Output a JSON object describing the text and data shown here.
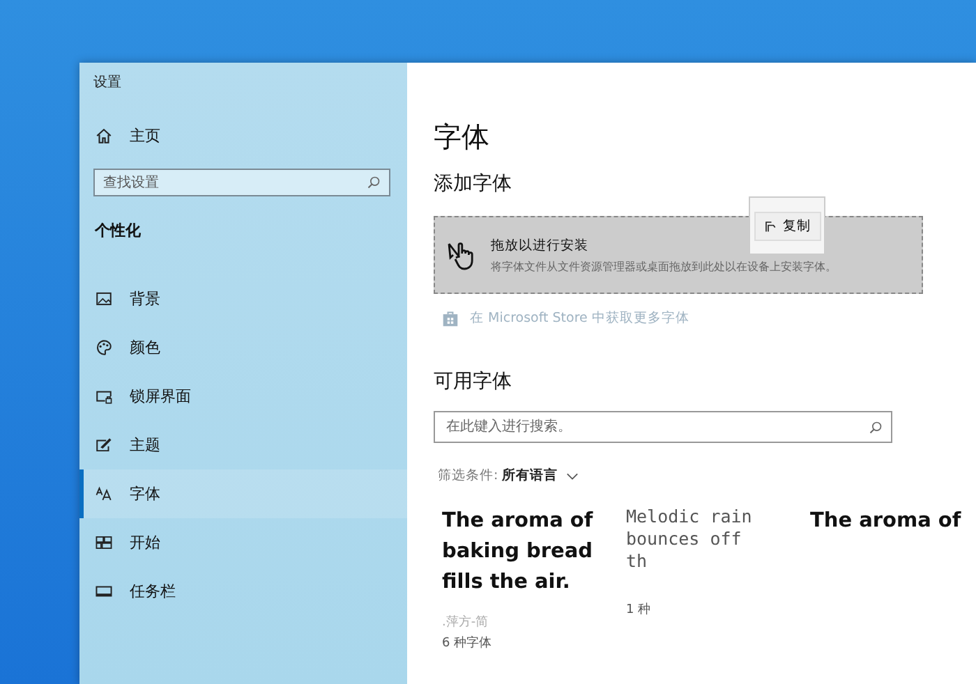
{
  "window": {
    "title": "设置"
  },
  "sidebar": {
    "home": "主页",
    "search": {
      "placeholder": "查找设置"
    },
    "section": "个性化",
    "items": [
      {
        "label": "背景",
        "kind": "image",
        "selected": false
      },
      {
        "label": "颜色",
        "kind": "palette",
        "selected": false
      },
      {
        "label": "锁屏界面",
        "kind": "lock",
        "selected": false
      },
      {
        "label": "主题",
        "kind": "theme",
        "selected": false
      },
      {
        "label": "字体",
        "kind": "font",
        "selected": true
      },
      {
        "label": "开始",
        "kind": "start",
        "selected": false
      },
      {
        "label": "任务栏",
        "kind": "taskbar",
        "selected": false
      }
    ]
  },
  "main": {
    "title": "字体",
    "add_heading": "添加字体",
    "drop_zone": {
      "title": "拖放以进行安装",
      "description": "将字体文件从文件资源管理器或桌面拖放到此处以在设备上安装字体。"
    },
    "drag_tooltip": "复制",
    "store_link": "在 Microsoft Store 中获取更多字体",
    "available_heading": "可用字体",
    "search": {
      "placeholder": "在此键入进行搜索。"
    },
    "filter": {
      "label": "筛选条件:",
      "value": "所有语言"
    },
    "fonts": [
      {
        "kind": "sans",
        "preview": "The aroma of baking bread fills the air.",
        "name": ".萍方-简",
        "count": "6 种字体"
      },
      {
        "kind": "mono",
        "preview": "Melodic rain bounces off th",
        "count": "1 种"
      },
      {
        "kind": "sans",
        "preview": "The aroma of"
      }
    ]
  }
}
